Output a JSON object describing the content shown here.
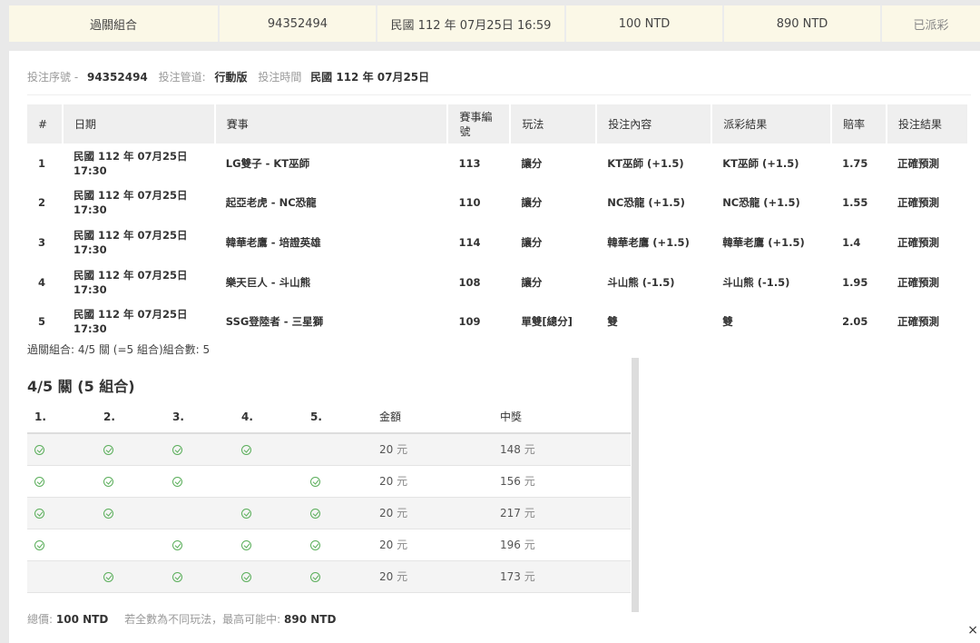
{
  "summary": {
    "type": "過關組合",
    "bet_id": "94352494",
    "datetime": "民國 112 年 07月25日 16:59",
    "stake": "100 NTD",
    "payout": "890 NTD",
    "status": "已派彩"
  },
  "meta": {
    "serial_label": "投注序號 -",
    "serial_value": "94352494",
    "channel_label": "投注管道:",
    "channel_value": "行動版",
    "time_label": "投注時間",
    "time_value": "民國 112 年 07月25日"
  },
  "bets": {
    "headers": [
      "#",
      "日期",
      "賽事",
      "賽事編號",
      "玩法",
      "投注內容",
      "派彩結果",
      "賠率",
      "投注結果"
    ],
    "rows": [
      {
        "no": "1",
        "date": "民國 112 年 07月25日",
        "time": "17:30",
        "match": "LG雙子 - KT巫師",
        "match_no": "113",
        "play": "讓分",
        "pick": "KT巫師 (+1.5)",
        "result": "KT巫師 (+1.5)",
        "odds": "1.75",
        "outcome": "正確預測"
      },
      {
        "no": "2",
        "date": "民國 112 年 07月25日",
        "time": "17:30",
        "match": "起亞老虎 - NC恐龍",
        "match_no": "110",
        "play": "讓分",
        "pick": "NC恐龍 (+1.5)",
        "result": "NC恐龍 (+1.5)",
        "odds": "1.55",
        "outcome": "正確預測"
      },
      {
        "no": "3",
        "date": "民國 112 年 07月25日",
        "time": "17:30",
        "match": "韓華老鷹 - 培證英雄",
        "match_no": "114",
        "play": "讓分",
        "pick": "韓華老鷹 (+1.5)",
        "result": "韓華老鷹 (+1.5)",
        "odds": "1.4",
        "outcome": "正確預測"
      },
      {
        "no": "4",
        "date": "民國 112 年 07月25日",
        "time": "17:30",
        "match": "樂天巨人 - 斗山熊",
        "match_no": "108",
        "play": "讓分",
        "pick": "斗山熊 (-1.5)",
        "result": "斗山熊 (-1.5)",
        "odds": "1.95",
        "outcome": "正確預測"
      },
      {
        "no": "5",
        "date": "民國 112 年 07月25日",
        "time": "17:30",
        "match": "SSG登陸者 - 三星獅",
        "match_no": "109",
        "play": "單雙[總分]",
        "pick": "雙",
        "result": "雙",
        "odds": "2.05",
        "outcome": "正確預測"
      }
    ]
  },
  "combo_summary": "過關組合: 4/5 關 (=5 組合)組合數: 5",
  "combo": {
    "title": "4/5 關 (5 組合)",
    "headers": [
      "1.",
      "2.",
      "3.",
      "4.",
      "5.",
      "金額",
      "中獎"
    ],
    "currency": "元",
    "rows": [
      {
        "legs": [
          true,
          true,
          true,
          true,
          false
        ],
        "amount": "20",
        "win": "148"
      },
      {
        "legs": [
          true,
          true,
          true,
          false,
          true
        ],
        "amount": "20",
        "win": "156"
      },
      {
        "legs": [
          true,
          true,
          false,
          true,
          true
        ],
        "amount": "20",
        "win": "217"
      },
      {
        "legs": [
          true,
          false,
          true,
          true,
          true
        ],
        "amount": "20",
        "win": "196"
      },
      {
        "legs": [
          false,
          true,
          true,
          true,
          true
        ],
        "amount": "20",
        "win": "173"
      }
    ]
  },
  "footer": {
    "total_label": "總價:",
    "total_value": "100 NTD",
    "max_label": "若全數為不同玩法，最高可能中:",
    "max_value": "890 NTD"
  },
  "close_icon": "×",
  "colors": {
    "check": "#5aae5a",
    "summary_bg": "#fbf8e7"
  }
}
